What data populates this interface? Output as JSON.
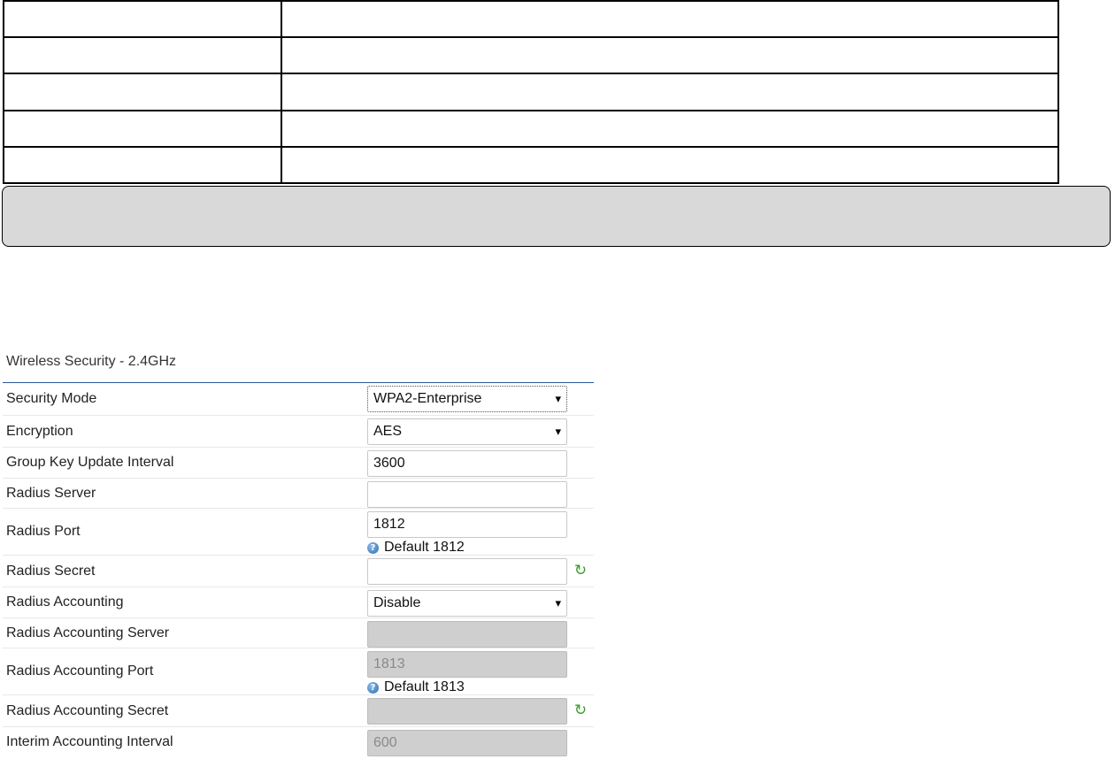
{
  "panel": {
    "title": "Wireless Security - 2.4GHz"
  },
  "fields": {
    "security_mode": {
      "label": "Security Mode",
      "value": "WPA2-Enterprise"
    },
    "encryption": {
      "label": "Encryption",
      "value": "AES"
    },
    "group_key_interval": {
      "label": "Group Key Update Interval",
      "value": "3600"
    },
    "radius_server": {
      "label": "Radius Server",
      "value": ""
    },
    "radius_port": {
      "label": "Radius Port",
      "value": "1812",
      "hint": "Default 1812"
    },
    "radius_secret": {
      "label": "Radius Secret",
      "value": ""
    },
    "radius_accounting": {
      "label": "Radius Accounting",
      "value": "Disable"
    },
    "radius_accounting_server": {
      "label": "Radius Accounting Server",
      "value": ""
    },
    "radius_accounting_port": {
      "label": "Radius Accounting Port",
      "value": "1813",
      "hint": "Default 1813"
    },
    "radius_accounting_secret": {
      "label": "Radius Accounting Secret",
      "value": ""
    },
    "interim_accounting_interval": {
      "label": "Interim Accounting Interval",
      "value": "600"
    }
  },
  "icons": {
    "help": "help-icon",
    "refresh": "refresh-icon"
  },
  "colors": {
    "title_rule": "#2a5a96",
    "disabled_field": "#cfcfcf",
    "refresh_icon": "#3a9a2a",
    "help_icon": "#2f6fb5"
  }
}
